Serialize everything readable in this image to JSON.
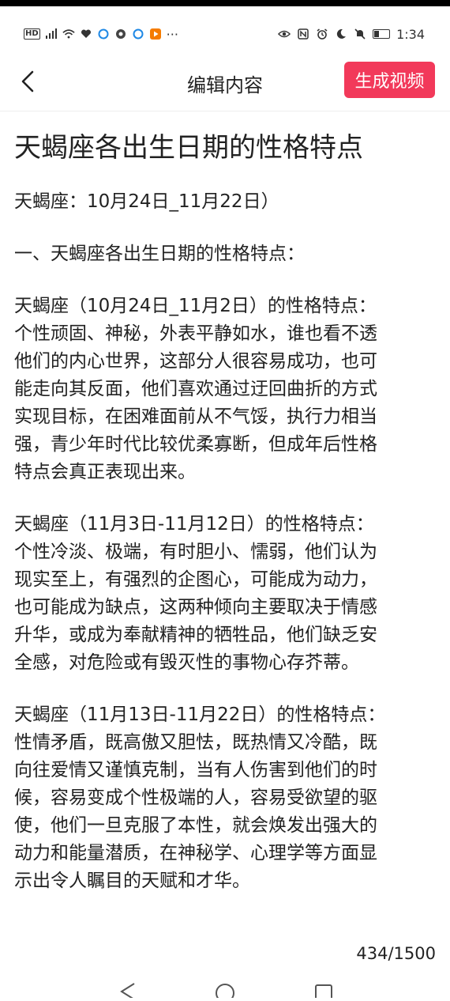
{
  "status_bar": {
    "time": "1:34",
    "left_icons": [
      "hd-icon",
      "signal-icon",
      "wifi-icon",
      "heart-icon",
      "app-icon",
      "app-icon",
      "app-icon",
      "play-icon",
      "more-dots-icon"
    ],
    "right_icons": [
      "eye-icon",
      "nfc-icon",
      "alarm-icon",
      "moon-icon",
      "mute-icon",
      "battery-icon"
    ],
    "hd": "HD",
    "more": "···",
    "battery_level": 0.3
  },
  "nav": {
    "title": "编辑内容",
    "generate_label": "生成视频",
    "accent": "#f2395a"
  },
  "article": {
    "title": "天蝎座各出生日期的性格特点",
    "paragraphs": [
      [
        "天蝎座：10月24日_11月22日）"
      ],
      [
        "一、天蝎座各出生日期的性格特点："
      ],
      [
        "天蝎座（10月24日_11月2日）的性格特点：",
        "个性顽固、神秘，外表平静如水，谁也看不透",
        "他们的内心世界，这部分人很容易成功，也可",
        "能走向其反面，他们喜欢通过迂回曲折的方式",
        "实现目标，在困难面前从不气馁，执行力相当",
        "强，青少年时代比较优柔寡断，但成年后性格",
        "特点会真正表现出来。"
      ],
      [
        "天蝎座（11月3日-11月12日）的性格特点：",
        "个性冷淡、极端，有时胆小、懦弱，他们认为",
        "现实至上，有强烈的企图心，可能成为动力，",
        "也可能成为缺点，这两种倾向主要取决于情感",
        "升华，或成为奉献精神的牺牲品，他们缺乏安",
        "全感，对危险或有毁灭性的事物心存芥蒂。"
      ],
      [
        "天蝎座（11月13日-11月22日）的性格特点：",
        "性情矛盾，既高傲又胆怯，既热情又冷酷，既",
        "向往爱情又谨慎克制，当有人伤害到他们的时",
        "候，容易变成个性极端的人，容易受欲望的驱",
        "使，他们一旦克服了本性，就会焕发出强大的",
        "动力和能量潜质，在神秘学、心理学等方面显",
        "示出令人瞩目的天赋和才华。"
      ]
    ]
  },
  "counter": "434/1500"
}
